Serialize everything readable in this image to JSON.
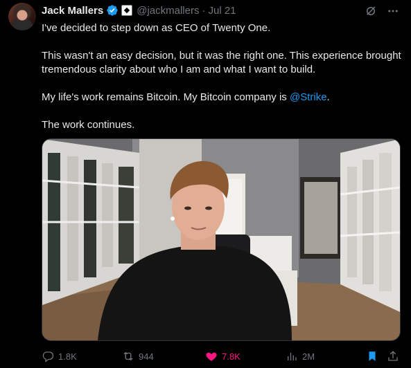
{
  "author": {
    "name": "Jack Mallers",
    "handle": "@jackmallers",
    "separator": "·",
    "date": "Jul 21",
    "avatar_icon": "profile-photo",
    "verified_icon": "verified-badge-icon",
    "affiliation_icon": "affiliate-badge-icon"
  },
  "tweet": {
    "line1": "I've decided to step down as CEO of Twenty One.",
    "para2": "This wasn't an easy decision, but it was the right one. This experience brought tremendous clarity about who I am and what I want to build.",
    "para3_prefix": "My life's work remains Bitcoin. My Bitcoin company is ",
    "para3_link": "@Strike",
    "para3_suffix": ".",
    "para4": "The work continues."
  },
  "actions": {
    "replies": "1.8K",
    "reposts": "944",
    "likes": "7.8K",
    "views": "2M"
  },
  "colors": {
    "background": "#000000",
    "text": "#e7e9ea",
    "muted": "#71767b",
    "link": "#1d9bf0",
    "like": "#f91880",
    "bookmark": "#1d9bf0"
  }
}
